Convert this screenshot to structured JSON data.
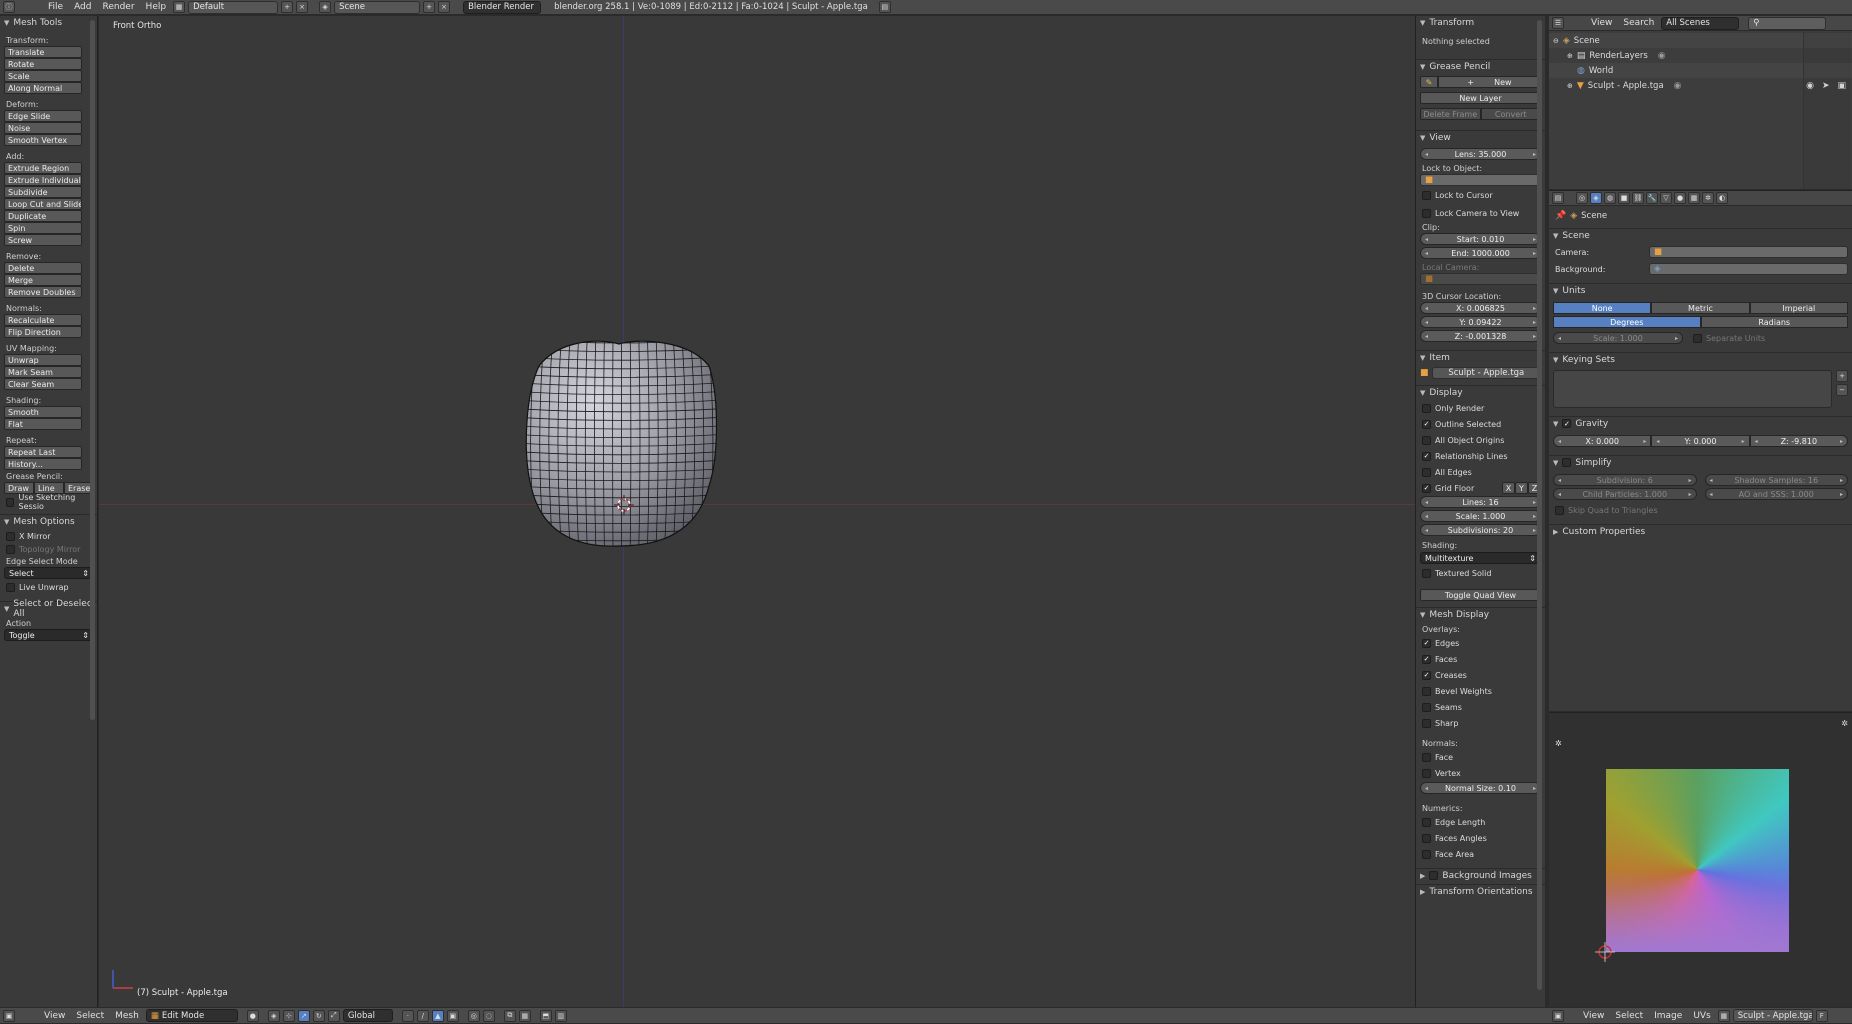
{
  "top_bar": {
    "menus": [
      "File",
      "Add",
      "Render",
      "Help"
    ],
    "screen_layout": "Default",
    "scene": "Scene",
    "render_engine": "Blender Render",
    "info": "blender.org 258.1 | Ve:0-1089 | Ed:0-2112 | Fa:0-1024 | Sculpt - Apple.tga"
  },
  "tool_shelf": {
    "title": "Mesh Tools",
    "sections": [
      {
        "label": "Transform:",
        "buttons": [
          "Translate",
          "Rotate",
          "Scale",
          "Along Normal"
        ]
      },
      {
        "label": "Deform:",
        "buttons": [
          "Edge Slide",
          "Noise",
          "Smooth Vertex"
        ]
      },
      {
        "label": "Add:",
        "buttons": [
          "Extrude Region",
          "Extrude Individual",
          "Subdivide",
          "Loop Cut and Slide",
          "Duplicate",
          "Spin",
          "Screw"
        ]
      },
      {
        "label": "Remove:",
        "buttons": [
          "Delete",
          "Merge",
          "Remove Doubles"
        ]
      },
      {
        "label": "Normals:",
        "buttons": [
          "Recalculate",
          "Flip Direction"
        ]
      },
      {
        "label": "UV Mapping:",
        "buttons": [
          "Unwrap",
          "Mark Seam",
          "Clear Seam"
        ]
      },
      {
        "label": "Shading:",
        "buttons": [
          "Smooth",
          "Flat"
        ]
      },
      {
        "label": "Repeat:",
        "buttons": [
          "Repeat Last",
          "History..."
        ]
      }
    ],
    "grease_pencil_label": "Grease Pencil:",
    "grease_buttons": [
      "Draw",
      "Line",
      "Erase"
    ],
    "use_sketching": "Use Sketching Sessio",
    "mesh_options": {
      "title": "Mesh Options",
      "x_mirror": "X Mirror",
      "topology_mirror": "Topology Mirror",
      "edge_select_mode": "Edge Select Mode",
      "select_value": "Select",
      "live_unwrap": "Live Unwrap"
    },
    "operator": {
      "title": "Select or Deselect All",
      "action_label": "Action",
      "action_value": "Toggle"
    }
  },
  "viewport": {
    "view_name": "Front Ortho",
    "object_label": "(7) Sculpt - Apple.tga"
  },
  "properties_panel": {
    "transform": {
      "title": "Transform",
      "status": "Nothing selected"
    },
    "grease_pencil": {
      "title": "Grease Pencil",
      "new": "New",
      "new_layer": "New Layer",
      "delete_frame": "Delete Frame",
      "convert": "Convert"
    },
    "view": {
      "title": "View",
      "lens": "Lens: 35.000",
      "lock_to_object": "Lock to Object:",
      "lock_to_cursor": "Lock to Cursor",
      "lock_camera": "Lock Camera to View",
      "clip": "Clip:",
      "clip_start": "Start: 0.010",
      "clip_end": "End: 1000.000",
      "local_camera": "Local Camera:",
      "cursor_loc": "3D Cursor Location:",
      "cx": "X: 0.006825",
      "cy": "Y: 0.09422",
      "cz": "Z: -0.001328"
    },
    "item": {
      "title": "Item",
      "name": "Sculpt - Apple.tga"
    },
    "display": {
      "title": "Display",
      "only_render": "Only Render",
      "outline_selected": "Outline Selected",
      "all_object_origins": "All Object Origins",
      "relationship_lines": "Relationship Lines",
      "all_edges": "All Edges",
      "grid_floor": "Grid Floor",
      "x": "X",
      "y": "Y",
      "z": "Z",
      "lines": "Lines: 16",
      "scale": "Scale: 1.000",
      "subdivisions": "Subdivisions: 20",
      "shading": "Shading:",
      "shading_value": "Multitexture",
      "textured_solid": "Textured Solid",
      "toggle_quad": "Toggle Quad View"
    },
    "mesh_display": {
      "title": "Mesh Display",
      "overlays": "Overlays:",
      "edges": "Edges",
      "faces": "Faces",
      "creases": "Creases",
      "bevel_weights": "Bevel Weights",
      "seams": "Seams",
      "sharp": "Sharp",
      "normals": "Normals:",
      "face": "Face",
      "vertex": "Vertex",
      "normal_size": "Normal Size: 0.10",
      "numerics": "Numerics:",
      "edge_length": "Edge Length",
      "faces_angles": "Faces Angles",
      "face_area": "Face Area"
    },
    "background_images": "Background Images",
    "transform_orientations": "Transform Orientations"
  },
  "outliner": {
    "menus": [
      "View",
      "Search"
    ],
    "filter": "All Scenes",
    "items": [
      "Scene",
      "RenderLayers",
      "World",
      "Sculpt - Apple.tga"
    ]
  },
  "scene_props": {
    "breadcrumb": "Scene",
    "scene": {
      "title": "Scene",
      "camera": "Camera:",
      "background": "Background:"
    },
    "units": {
      "title": "Units",
      "systems": [
        "None",
        "Metric",
        "Imperial"
      ],
      "rotation": [
        "Degrees",
        "Radians"
      ],
      "scale": "Scale: 1.000",
      "separate_units": "Separate Units"
    },
    "keying_sets": {
      "title": "Keying Sets"
    },
    "gravity": {
      "title": "Gravity",
      "x": "X: 0.000",
      "y": "Y: 0.000",
      "z": "Z: -9.810"
    },
    "simplify": {
      "title": "Simplify",
      "subdivision": "Subdivision: 6",
      "shadow_samples": "Shadow Samples: 16",
      "child_particles": "Child Particles: 1.000",
      "ao_sss": "AO and SSS: 1.000",
      "skip_quad": "Skip Quad to Triangles"
    },
    "custom_properties": "Custom Properties"
  },
  "uv_editor": {
    "menus": [
      "View",
      "Select",
      "Image",
      "UVs"
    ],
    "image_name": "Sculpt - Apple.tga"
  },
  "bottom_bar": {
    "menus": [
      "View",
      "Select",
      "Mesh"
    ],
    "mode": "Edit Mode",
    "orientation": "Global"
  }
}
